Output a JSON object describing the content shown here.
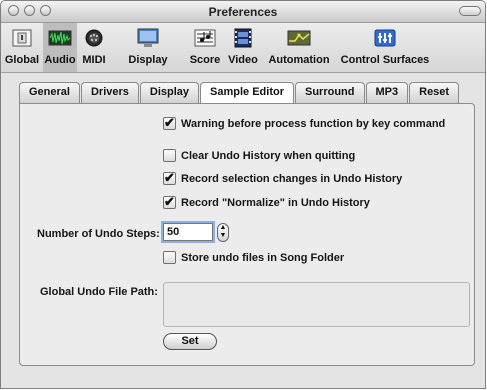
{
  "window": {
    "title": "Preferences"
  },
  "toolbar": {
    "items": [
      {
        "label": "Global",
        "icon": "global-icon"
      },
      {
        "label": "Audio",
        "icon": "audio-icon",
        "selected": true
      },
      {
        "label": "MIDI",
        "icon": "midi-icon"
      },
      {
        "label": "Display",
        "icon": "display-icon"
      },
      {
        "label": "Score",
        "icon": "score-icon"
      },
      {
        "label": "Video",
        "icon": "video-icon"
      },
      {
        "label": "Automation",
        "icon": "automation-icon"
      },
      {
        "label": "Control Surfaces",
        "icon": "control-surfaces-icon"
      }
    ]
  },
  "tabs": [
    {
      "label": "General"
    },
    {
      "label": "Drivers"
    },
    {
      "label": "Display"
    },
    {
      "label": "Sample Editor",
      "active": true
    },
    {
      "label": "Surround"
    },
    {
      "label": "MP3"
    },
    {
      "label": "Reset"
    }
  ],
  "options": {
    "warning_process": {
      "label": "Warning before process function by key command",
      "checked": true
    },
    "clear_undo": {
      "label": "Clear Undo History when quitting",
      "checked": false
    },
    "record_selection": {
      "label": "Record selection changes in Undo History",
      "checked": true
    },
    "record_normalize": {
      "label": "Record \"Normalize\" in Undo History",
      "checked": true
    },
    "store_undo": {
      "label": "Store undo files in Song Folder",
      "checked": false
    }
  },
  "undo_steps": {
    "label": "Number of Undo Steps:",
    "value": "50"
  },
  "undo_path": {
    "label": "Global Undo File Path:",
    "value": ""
  },
  "set_button": {
    "label": "Set"
  }
}
